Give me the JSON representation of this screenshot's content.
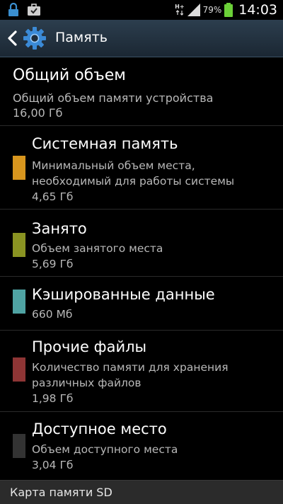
{
  "status_bar": {
    "network_type": "H+",
    "battery_percent": "79%",
    "time": "14:03"
  },
  "action_bar": {
    "title": "Память",
    "icons": [
      "chevron-left-icon",
      "gear-icon"
    ]
  },
  "total": {
    "title": "Общий объем",
    "description": "Общий объем памяти устройства",
    "value": "16,00 Гб"
  },
  "items": [
    {
      "title": "Системная память",
      "description_lines": [
        "Минимальный объем места,",
        "необходимый для работы системы"
      ],
      "value": "4,65 Гб",
      "color": "#d8961e"
    },
    {
      "title": "Занято",
      "description_lines": [
        "Объем занятого места"
      ],
      "value": "5,69 Гб",
      "color": "#8a9322"
    },
    {
      "title": "Кэшированные данные",
      "description_lines": [],
      "value": "660 Мб",
      "color": "#4fa3a3"
    },
    {
      "title": "Прочие файлы",
      "description_lines": [
        "Количество памяти для хранения",
        "различных файлов"
      ],
      "value": "1,98 Гб",
      "color": "#8e3535"
    },
    {
      "title": "Доступное место",
      "description_lines": [
        "Объем доступного места"
      ],
      "value": "3,04 Гб",
      "color": "#333333"
    }
  ],
  "sd_card": {
    "header": "Карта памяти SD"
  }
}
